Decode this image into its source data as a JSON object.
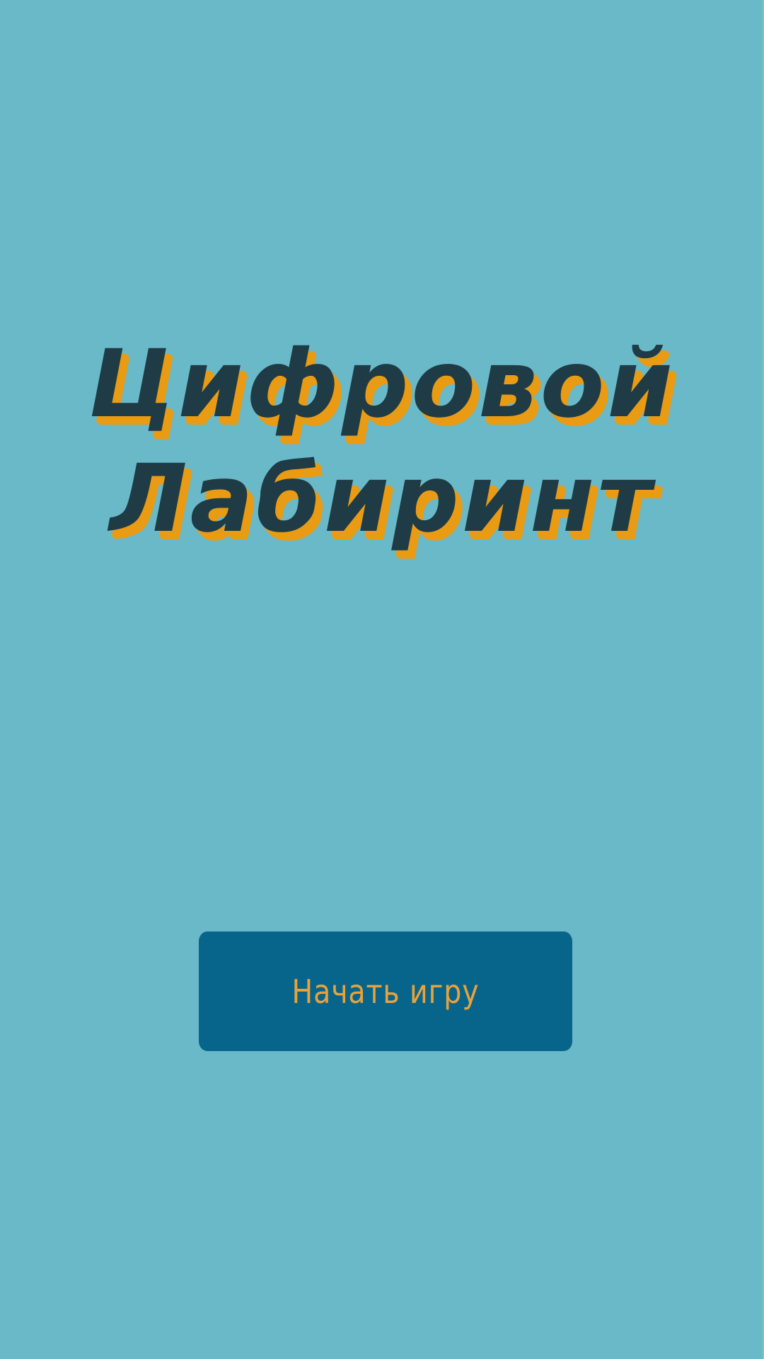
{
  "title": {
    "line1": "Цифровой",
    "line2": "Лабиринт"
  },
  "start_button": {
    "label": "Начать игру"
  },
  "colors": {
    "background": "#6ab9c9",
    "title_text": "#1f3b45",
    "title_shadow": "#e99b14",
    "button_background": "#07658c",
    "button_text": "#e9a23b"
  }
}
